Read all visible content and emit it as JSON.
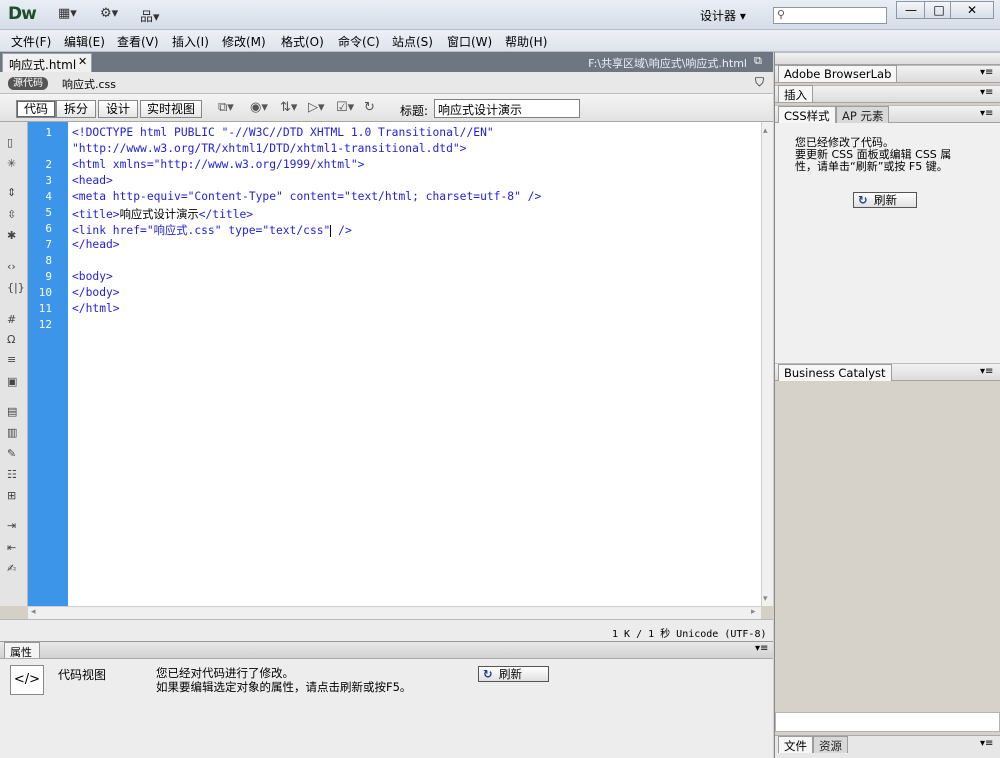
{
  "app": {
    "logo": "Dw",
    "workspace": "设计器",
    "search_placeholder": ""
  },
  "window_buttons": {
    "minimize": "—",
    "maximize": "□",
    "close": "✕"
  },
  "menu": [
    "文件(F)",
    "编辑(E)",
    "查看(V)",
    "插入(I)",
    "修改(M)",
    "格式(O)",
    "命令(C)",
    "站点(S)",
    "窗口(W)",
    "帮助(H)"
  ],
  "document": {
    "tab": "响应式.html",
    "path": "F:\\共享区域\\响应式\\响应式.html",
    "source_badge": "源代码",
    "related_file": "响应式.css",
    "view_buttons": [
      "代码",
      "拆分",
      "设计",
      "实时视图"
    ],
    "title_label": "标题:",
    "title_value": "响应式设计演示"
  },
  "code": {
    "line_numbers": [
      "1",
      "2",
      "3",
      "4",
      "5",
      "6",
      "7",
      "8",
      "9",
      "10",
      "11",
      "12"
    ],
    "lines": [
      "<!DOCTYPE html PUBLIC \"-//W3C//DTD XHTML 1.0 Transitional//EN\"",
      "\"http://www.w3.org/TR/xhtml1/DTD/xhtml1-transitional.dtd\">",
      "<html xmlns=\"http://www.w3.org/1999/xhtml\">",
      "<head>",
      "<meta http-equiv=\"Content-Type\" content=\"text/html; charset=utf-8\" />",
      "<title>",
      "响应式设计演示",
      "</title>",
      "<link href=\"",
      "响应式.css",
      "\" type=\"text/css\"",
      " />",
      "</head>",
      "<body>",
      "</body>",
      "</html>"
    ]
  },
  "status": {
    "text": "1 K / 1 秒 Unicode (UTF-8)"
  },
  "properties": {
    "header": "属性",
    "view_label": "代码视图",
    "message_line1": "您已经对代码进行了修改。",
    "message_line2": "如果要编辑选定对象的属性，请点击刷新或按F5。",
    "refresh": "刷新"
  },
  "right_panels": {
    "browserlab": "Adobe BrowserLab",
    "insert": "插入",
    "css_tab": "CSS样式",
    "ap_tab": "AP 元素",
    "css_msg_line1": "您已经修改了代码。",
    "css_msg_line2": "要更新 CSS 面板或编辑 CSS 属",
    "css_msg_line3": "性，请单击“刷新”或按 F5 键。",
    "css_refresh": "刷新",
    "business_catalyst": "Business Catalyst",
    "files_tab": "文件",
    "assets_tab": "资源"
  }
}
